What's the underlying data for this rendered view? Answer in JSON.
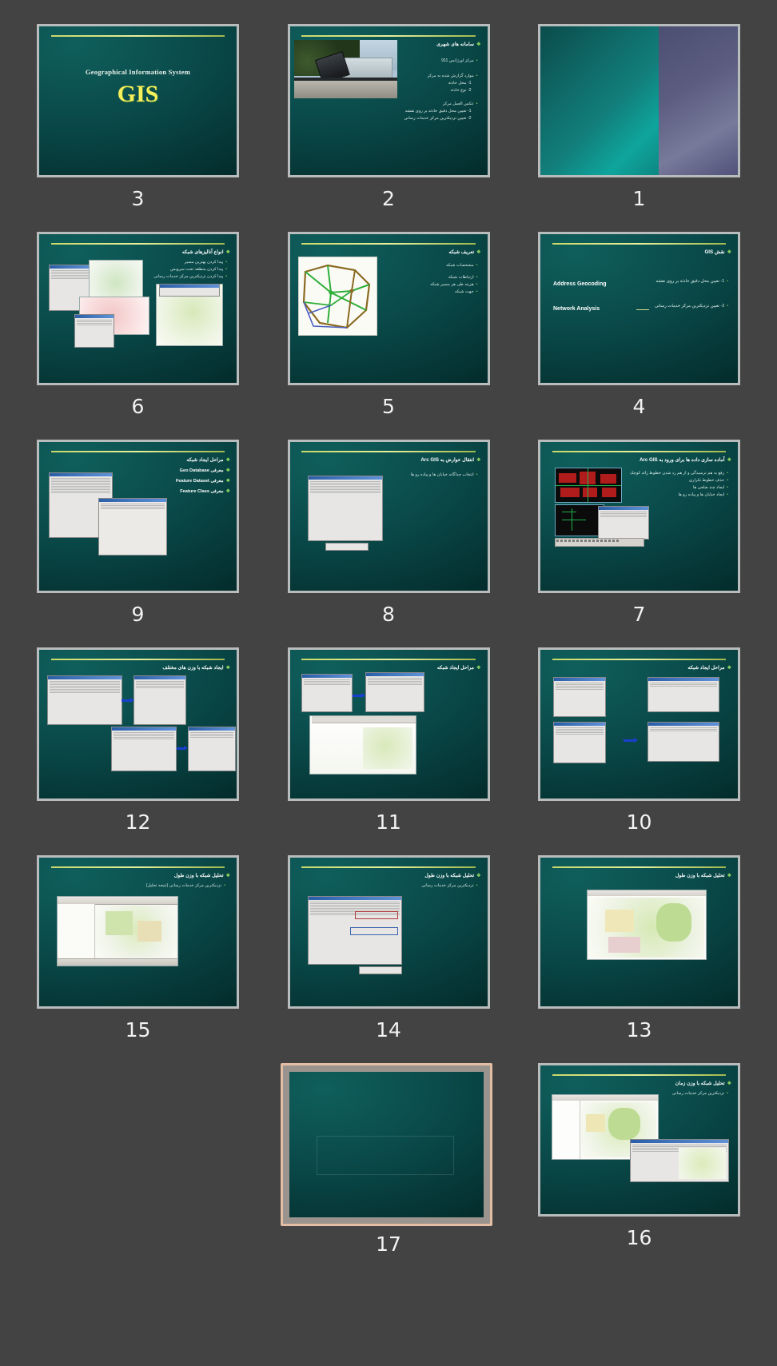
{
  "app": {
    "background_color": "#434343",
    "caption_color": "#f2f2f2",
    "slide_frame_color": "#b8bcbc",
    "selection_border_color": "#e3bda4",
    "title_rule_color": "#c9d86a",
    "bullet_color": "#8fd45e"
  },
  "slides": [
    {
      "number": "3",
      "kind": "title-slide",
      "selected": false,
      "title_line1": "Geographical Information System",
      "title_line2": "GIS",
      "bullets": []
    },
    {
      "number": "2",
      "kind": "photo-bullets",
      "selected": false,
      "title": "سامانه های شهری",
      "bullets": [
        "مرکز اورژانس 911",
        "موارد گزارش شده به مرکز",
        "1- محل حادثه",
        "2- نوع حادثه",
        "عکس العمل مرکز",
        "1- تعیین محل دقیق حادثه بر روی نقشه",
        "2- تعیین نزدیکترین مرکز خدمات رسانی"
      ],
      "image": "truck-accident-photo"
    },
    {
      "number": "1",
      "kind": "blank-gradient",
      "selected": false,
      "title": "",
      "bullets": []
    },
    {
      "number": "6",
      "kind": "screenshots",
      "selected": false,
      "title": "انواع آنالیزهای شبکه",
      "bullets": [
        "پیدا کردن بهترین مسیر",
        "پیدا کردن منطقه تحت سرویس",
        "پیدا کردن نزدیکترین مرکز خدمات رسانی"
      ]
    },
    {
      "number": "5",
      "kind": "network-map",
      "selected": false,
      "title": "تعریف شبکه",
      "bullets": [
        "مشخصات شبکه",
        "ارتباطات شبکه",
        "هزینه طی هر مسیر شبکه",
        "جهت شبکه"
      ]
    },
    {
      "number": "4",
      "kind": "english-terms",
      "selected": false,
      "title": "نقش GIS",
      "bullets": [
        "1- تعیین محل دقیق حادثه بر روی نقشه",
        "2- تعیین نزدیکترین مرکز خدمات رسانی"
      ],
      "english_terms": [
        "Address Geocoding",
        "Network Analysis"
      ]
    },
    {
      "number": "9",
      "kind": "screenshots",
      "selected": false,
      "title": "مراحل ایجاد شبکه",
      "bullets": [
        "معرفی Geo Database",
        "معرفی Feature Dataset",
        "معرفی Feature Class"
      ]
    },
    {
      "number": "8",
      "kind": "screenshots",
      "selected": false,
      "title": "انتقال عوارض به Arc GIS",
      "bullets": [
        "انتخاب جداگانه خیابان ها و پیاده رو ها"
      ]
    },
    {
      "number": "7",
      "kind": "screenshots",
      "selected": false,
      "title": "آماده سازی داده ها برای ورود به Arc GIS",
      "bullets": [
        "رفع به هم ترسیدگی و از هم رد شدن خطوط زائد کوچک",
        "حذف خطوط تکراری",
        "ایجاد چند ضلعی ها",
        "ایجاد خیابان ها و پیاده رو ها"
      ]
    },
    {
      "number": "12",
      "kind": "screenshots",
      "selected": false,
      "title": "ایجاد شبکه با وزن های مختلف",
      "bullets": []
    },
    {
      "number": "11",
      "kind": "screenshots",
      "selected": false,
      "title": "مراحل ایجاد شبکه",
      "bullets": []
    },
    {
      "number": "10",
      "kind": "screenshots",
      "selected": false,
      "title": "مراحل ایجاد شبکه",
      "bullets": []
    },
    {
      "number": "15",
      "kind": "screenshots",
      "selected": false,
      "title": "تحلیل شبکه با وزن طول",
      "bullets": [
        "نزدیکترین مرکز خدمات رسانی (نتیجه تحلیل)"
      ]
    },
    {
      "number": "14",
      "kind": "screenshots",
      "selected": false,
      "title": "تحلیل شبکه با وزن طول",
      "bullets": [
        "نزدیکترین مرکز خدمات رسانی"
      ]
    },
    {
      "number": "13",
      "kind": "screenshots",
      "selected": false,
      "title": "تحلیل شبکه با وزن طول",
      "bullets": []
    },
    {
      "number": "17",
      "kind": "blank-placeholder",
      "selected": true,
      "title": "",
      "bullets": []
    },
    {
      "number": "16",
      "kind": "screenshots",
      "selected": false,
      "title": "تحلیل شبکه با وزن زمان",
      "bullets": [
        "نزدیکترین مرکز خدمات رسانی"
      ]
    }
  ]
}
